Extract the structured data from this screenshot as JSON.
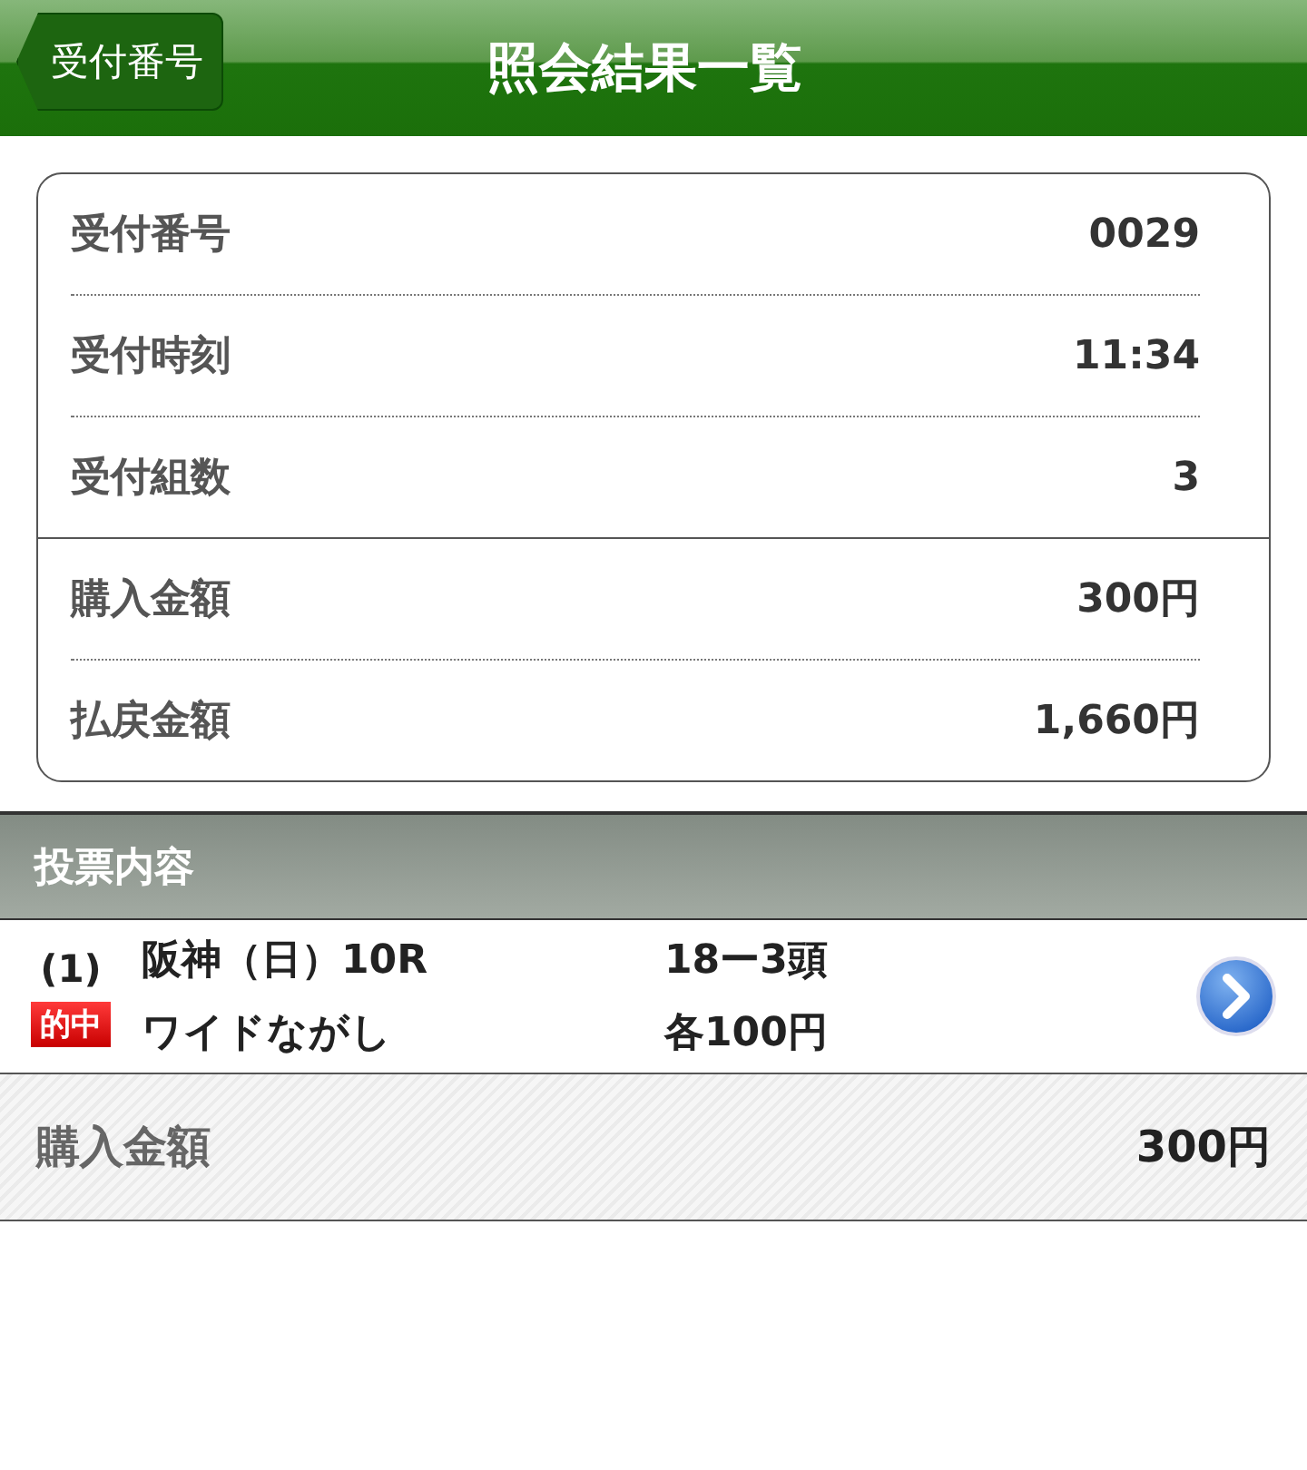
{
  "header": {
    "back_button": "受付番号",
    "title": "照会結果一覧"
  },
  "summary": {
    "groups": [
      [
        {
          "label": "受付番号",
          "value": "0029"
        },
        {
          "label": "受付時刻",
          "value": "11:34"
        },
        {
          "label": "受付組数",
          "value": "3"
        }
      ],
      [
        {
          "label": "購入金額",
          "value": "300円"
        },
        {
          "label": "払戻金額",
          "value": "1,660円"
        }
      ]
    ]
  },
  "section": {
    "title": "投票内容"
  },
  "bets": [
    {
      "number": "(1)",
      "badge": "的中",
      "race": "阪神（日）10R",
      "bet_type": "ワイドながし",
      "horses": "18ー3頭",
      "amount": "各100円"
    }
  ],
  "total": {
    "label": "購入金額",
    "value": "300円"
  }
}
